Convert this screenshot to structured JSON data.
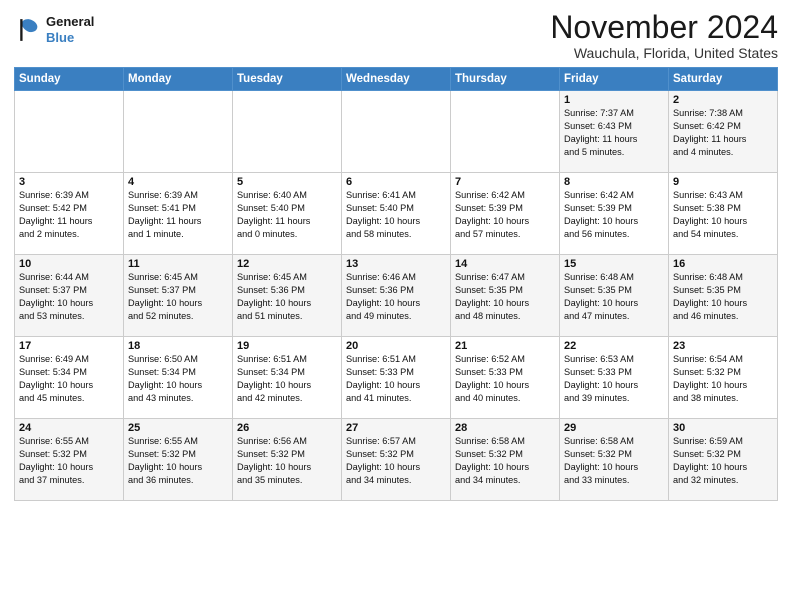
{
  "header": {
    "logo_line1": "General",
    "logo_line2": "Blue",
    "month": "November 2024",
    "location": "Wauchula, Florida, United States"
  },
  "weekdays": [
    "Sunday",
    "Monday",
    "Tuesday",
    "Wednesday",
    "Thursday",
    "Friday",
    "Saturday"
  ],
  "weeks": [
    [
      {
        "day": "",
        "info": ""
      },
      {
        "day": "",
        "info": ""
      },
      {
        "day": "",
        "info": ""
      },
      {
        "day": "",
        "info": ""
      },
      {
        "day": "",
        "info": ""
      },
      {
        "day": "1",
        "info": "Sunrise: 7:37 AM\nSunset: 6:43 PM\nDaylight: 11 hours\nand 5 minutes."
      },
      {
        "day": "2",
        "info": "Sunrise: 7:38 AM\nSunset: 6:42 PM\nDaylight: 11 hours\nand 4 minutes."
      }
    ],
    [
      {
        "day": "3",
        "info": "Sunrise: 6:39 AM\nSunset: 5:42 PM\nDaylight: 11 hours\nand 2 minutes."
      },
      {
        "day": "4",
        "info": "Sunrise: 6:39 AM\nSunset: 5:41 PM\nDaylight: 11 hours\nand 1 minute."
      },
      {
        "day": "5",
        "info": "Sunrise: 6:40 AM\nSunset: 5:40 PM\nDaylight: 11 hours\nand 0 minutes."
      },
      {
        "day": "6",
        "info": "Sunrise: 6:41 AM\nSunset: 5:40 PM\nDaylight: 10 hours\nand 58 minutes."
      },
      {
        "day": "7",
        "info": "Sunrise: 6:42 AM\nSunset: 5:39 PM\nDaylight: 10 hours\nand 57 minutes."
      },
      {
        "day": "8",
        "info": "Sunrise: 6:42 AM\nSunset: 5:39 PM\nDaylight: 10 hours\nand 56 minutes."
      },
      {
        "day": "9",
        "info": "Sunrise: 6:43 AM\nSunset: 5:38 PM\nDaylight: 10 hours\nand 54 minutes."
      }
    ],
    [
      {
        "day": "10",
        "info": "Sunrise: 6:44 AM\nSunset: 5:37 PM\nDaylight: 10 hours\nand 53 minutes."
      },
      {
        "day": "11",
        "info": "Sunrise: 6:45 AM\nSunset: 5:37 PM\nDaylight: 10 hours\nand 52 minutes."
      },
      {
        "day": "12",
        "info": "Sunrise: 6:45 AM\nSunset: 5:36 PM\nDaylight: 10 hours\nand 51 minutes."
      },
      {
        "day": "13",
        "info": "Sunrise: 6:46 AM\nSunset: 5:36 PM\nDaylight: 10 hours\nand 49 minutes."
      },
      {
        "day": "14",
        "info": "Sunrise: 6:47 AM\nSunset: 5:35 PM\nDaylight: 10 hours\nand 48 minutes."
      },
      {
        "day": "15",
        "info": "Sunrise: 6:48 AM\nSunset: 5:35 PM\nDaylight: 10 hours\nand 47 minutes."
      },
      {
        "day": "16",
        "info": "Sunrise: 6:48 AM\nSunset: 5:35 PM\nDaylight: 10 hours\nand 46 minutes."
      }
    ],
    [
      {
        "day": "17",
        "info": "Sunrise: 6:49 AM\nSunset: 5:34 PM\nDaylight: 10 hours\nand 45 minutes."
      },
      {
        "day": "18",
        "info": "Sunrise: 6:50 AM\nSunset: 5:34 PM\nDaylight: 10 hours\nand 43 minutes."
      },
      {
        "day": "19",
        "info": "Sunrise: 6:51 AM\nSunset: 5:34 PM\nDaylight: 10 hours\nand 42 minutes."
      },
      {
        "day": "20",
        "info": "Sunrise: 6:51 AM\nSunset: 5:33 PM\nDaylight: 10 hours\nand 41 minutes."
      },
      {
        "day": "21",
        "info": "Sunrise: 6:52 AM\nSunset: 5:33 PM\nDaylight: 10 hours\nand 40 minutes."
      },
      {
        "day": "22",
        "info": "Sunrise: 6:53 AM\nSunset: 5:33 PM\nDaylight: 10 hours\nand 39 minutes."
      },
      {
        "day": "23",
        "info": "Sunrise: 6:54 AM\nSunset: 5:32 PM\nDaylight: 10 hours\nand 38 minutes."
      }
    ],
    [
      {
        "day": "24",
        "info": "Sunrise: 6:55 AM\nSunset: 5:32 PM\nDaylight: 10 hours\nand 37 minutes."
      },
      {
        "day": "25",
        "info": "Sunrise: 6:55 AM\nSunset: 5:32 PM\nDaylight: 10 hours\nand 36 minutes."
      },
      {
        "day": "26",
        "info": "Sunrise: 6:56 AM\nSunset: 5:32 PM\nDaylight: 10 hours\nand 35 minutes."
      },
      {
        "day": "27",
        "info": "Sunrise: 6:57 AM\nSunset: 5:32 PM\nDaylight: 10 hours\nand 34 minutes."
      },
      {
        "day": "28",
        "info": "Sunrise: 6:58 AM\nSunset: 5:32 PM\nDaylight: 10 hours\nand 34 minutes."
      },
      {
        "day": "29",
        "info": "Sunrise: 6:58 AM\nSunset: 5:32 PM\nDaylight: 10 hours\nand 33 minutes."
      },
      {
        "day": "30",
        "info": "Sunrise: 6:59 AM\nSunset: 5:32 PM\nDaylight: 10 hours\nand 32 minutes."
      }
    ]
  ]
}
